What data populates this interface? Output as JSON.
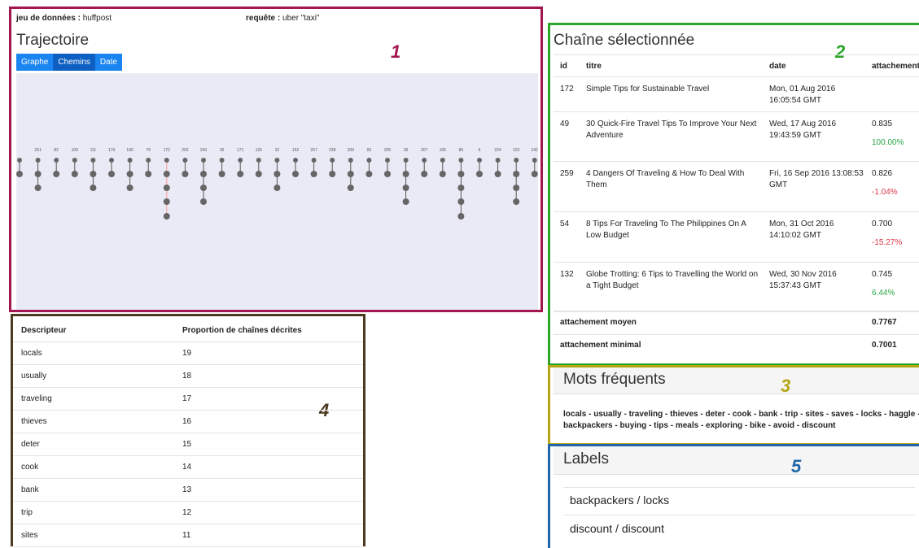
{
  "panel1": {
    "dataset_label": "jeu de données :",
    "dataset_value": "huffpost",
    "query_label": "requête :",
    "query_value": "uber \"taxi\"",
    "title": "Trajectoire",
    "tabs": [
      "Graphe",
      "Chemins",
      "Date"
    ],
    "number": "1",
    "columns": [
      {
        "top": "",
        "depth": 2
      },
      {
        "top": "251",
        "depth": 3
      },
      {
        "top": "82",
        "depth": 2
      },
      {
        "top": "109",
        "depth": 2
      },
      {
        "top": "111",
        "depth": 3
      },
      {
        "top": "179",
        "depth": 2
      },
      {
        "top": "190",
        "depth": 3
      },
      {
        "top": "79",
        "depth": 2
      },
      {
        "top": "172",
        "depth": 5
      },
      {
        "top": "202",
        "depth": 2
      },
      {
        "top": "243",
        "depth": 4
      },
      {
        "top": "36",
        "depth": 2
      },
      {
        "top": "171",
        "depth": 2
      },
      {
        "top": "126",
        "depth": 2
      },
      {
        "top": "32",
        "depth": 3
      },
      {
        "top": "152",
        "depth": 2
      },
      {
        "top": "257",
        "depth": 2
      },
      {
        "top": "238",
        "depth": 2
      },
      {
        "top": "209",
        "depth": 3
      },
      {
        "top": "93",
        "depth": 2
      },
      {
        "top": "205",
        "depth": 2
      },
      {
        "top": "36",
        "depth": 4
      },
      {
        "top": "207",
        "depth": 2
      },
      {
        "top": "105",
        "depth": 2
      },
      {
        "top": "86",
        "depth": 5
      },
      {
        "top": "6",
        "depth": 2
      },
      {
        "top": "224",
        "depth": 2
      },
      {
        "top": "102",
        "depth": 4
      },
      {
        "top": "242",
        "depth": 2
      }
    ]
  },
  "panel2": {
    "title": "Chaîne sélectionnée",
    "number": "2",
    "headers": {
      "id": "id",
      "titre": "titre",
      "date": "date",
      "attachement": "attachement"
    },
    "rows": [
      {
        "id": "172",
        "title1": "Simple Tips for Sustainable Travel",
        "title2": "",
        "date1": "Mon, 01 Aug 2016",
        "date2": "16:05:54 GMT",
        "att": "",
        "pct": "",
        "pct_color": ""
      },
      {
        "id": "49",
        "title1": "30 Quick-Fire Travel Tips To Improve Your Next",
        "title2": "Adventure",
        "date1": "Wed, 17 Aug 2016",
        "date2": "19:43:59 GMT",
        "att": "0.835",
        "pct": "100.00%",
        "pct_color": "green"
      },
      {
        "id": "259",
        "title1": "4 Dangers Of Traveling & How To Deal With",
        "title2": "Them",
        "date1": "Fri, 16 Sep 2016 13:08:53",
        "date2": "GMT",
        "att": "0.826",
        "pct": "-1.04%",
        "pct_color": "red"
      },
      {
        "id": "54",
        "title1": "8 Tips For Traveling To The Philippines On A",
        "title2": "Low Budget",
        "date1": "Mon, 31 Oct 2016",
        "date2": "14:10:02 GMT",
        "att": "0.700",
        "pct": "-15.27%",
        "pct_color": "red"
      },
      {
        "id": "132",
        "title1": "Globe Trotting: 6 Tips to Travelling the World on",
        "title2": "a Tight Budget",
        "date1": "Wed, 30 Nov 2016",
        "date2": "15:37:43 GMT",
        "att": "0.745",
        "pct": "6.44%",
        "pct_color": "green"
      }
    ],
    "summary": [
      {
        "label": "attachement moyen",
        "value": "0.7767"
      },
      {
        "label": "attachement minimal",
        "value": "0.7001"
      }
    ]
  },
  "panel3": {
    "title": "Mots fréquents",
    "number": "3",
    "line1": "locals - usually - traveling - thieves - deter - cook - bank - trip - sites - saves - locks - haggle -",
    "line2": "backpackers - buying - tips - meals - exploring - bike - avoid - discount"
  },
  "panel4": {
    "number": "4",
    "headers": {
      "desc": "Descripteur",
      "prop": "Proportion de chaînes décrites"
    },
    "rows": [
      {
        "d": "locals",
        "p": "19"
      },
      {
        "d": "usually",
        "p": "18"
      },
      {
        "d": "traveling",
        "p": "17"
      },
      {
        "d": "thieves",
        "p": "16"
      },
      {
        "d": "deter",
        "p": "15"
      },
      {
        "d": "cook",
        "p": "14"
      },
      {
        "d": "bank",
        "p": "13"
      },
      {
        "d": "trip",
        "p": "12"
      },
      {
        "d": "sites",
        "p": "11"
      }
    ]
  },
  "panel5": {
    "title": "Labels",
    "number": "5",
    "items": [
      "backpackers / locks",
      "discount / discount"
    ]
  },
  "colors": {
    "p1": "#a4164f",
    "p2": "#2aa52a",
    "p3": "#b5a616",
    "p4": "#4b3a1f",
    "p5": "#2066a8",
    "tab": "#1a84f0",
    "graph_bg": "#e9eaf5",
    "node": "#666666",
    "path_highlight": "#ff9aa2"
  }
}
